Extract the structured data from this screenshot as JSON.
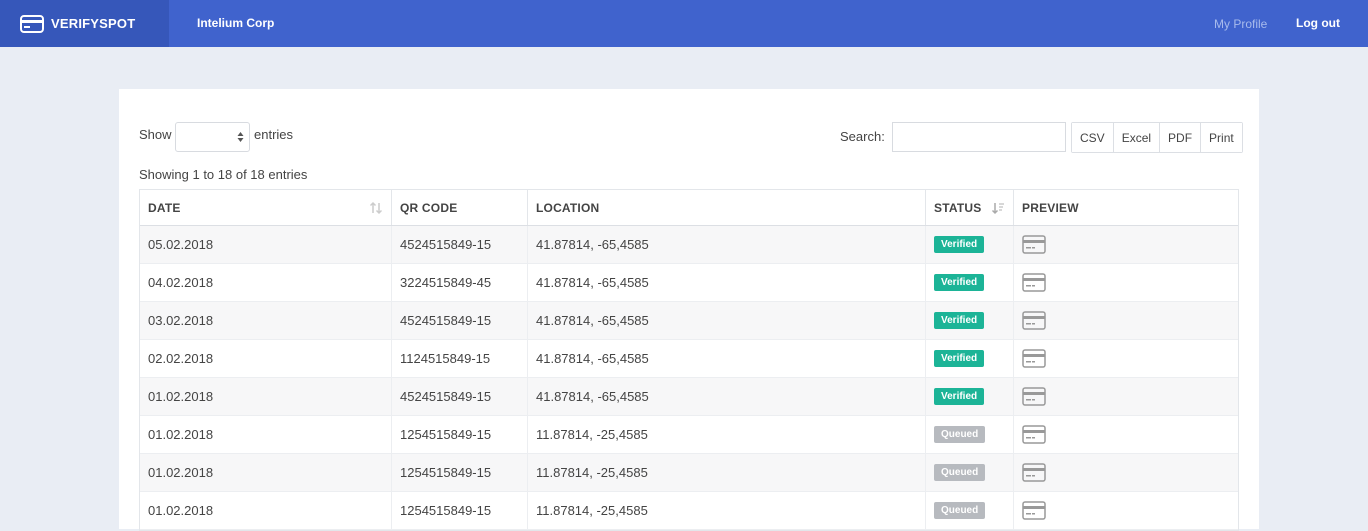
{
  "brand": {
    "name": "VERIFYSPOT"
  },
  "org": {
    "name": "Intelium Corp"
  },
  "nav": {
    "profile": "My Profile",
    "logout": "Log out"
  },
  "controls": {
    "show_label": "Show",
    "entries_label": "entries",
    "select_value": "",
    "search_label": "Search:",
    "search_value": "",
    "export_buttons": [
      "CSV",
      "Excel",
      "PDF",
      "Print"
    ]
  },
  "info": "Showing 1 to 18 of 18 entries",
  "table": {
    "columns": [
      "DATE",
      "QR CODE",
      "LOCATION",
      "STATUS",
      "PREVIEW"
    ],
    "rows": [
      {
        "date": "05.02.2018",
        "qr": "4524515849-15",
        "location": "41.87814, -65,4585",
        "status": "Verified"
      },
      {
        "date": "04.02.2018",
        "qr": "3224515849-45",
        "location": "41.87814, -65,4585",
        "status": "Verified"
      },
      {
        "date": "03.02.2018",
        "qr": "4524515849-15",
        "location": "41.87814, -65,4585",
        "status": "Verified"
      },
      {
        "date": "02.02.2018",
        "qr": "1124515849-15",
        "location": "41.87814, -65,4585",
        "status": "Verified"
      },
      {
        "date": "01.02.2018",
        "qr": "4524515849-15",
        "location": "41.87814, -65,4585",
        "status": "Verified"
      },
      {
        "date": "01.02.2018",
        "qr": "1254515849-15",
        "location": "11.87814, -25,4585",
        "status": "Queued"
      },
      {
        "date": "01.02.2018",
        "qr": "1254515849-15",
        "location": "11.87814, -25,4585",
        "status": "Queued"
      },
      {
        "date": "01.02.2018",
        "qr": "1254515849-15",
        "location": "11.87814, -25,4585",
        "status": "Queued"
      }
    ]
  },
  "colors": {
    "navbar": "#4063cd",
    "brand_bg": "#3657ba",
    "verified": "#1cb497",
    "queued": "#b7babf"
  },
  "icons": {
    "brand": "credit-card-icon",
    "preview": "card-preview-icon",
    "sort": "sort-icon"
  }
}
